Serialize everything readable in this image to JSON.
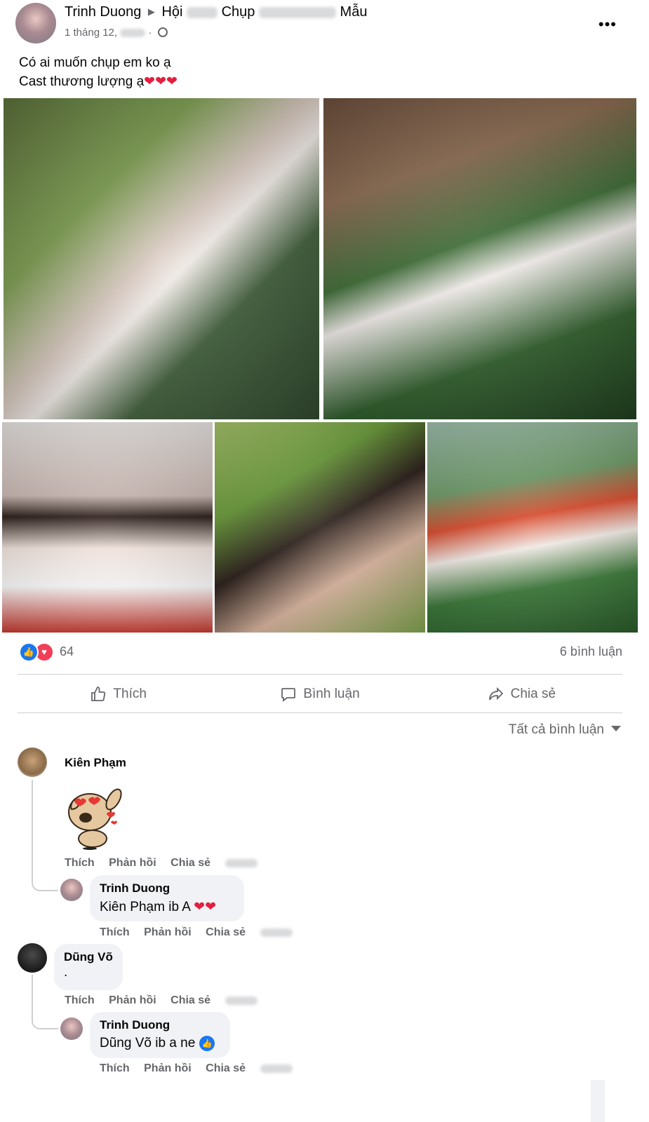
{
  "post": {
    "author": "Trinh Duong",
    "group_prefix": "Hội",
    "group_suffix": "Chụp",
    "group_last": "Mẫu",
    "date_prefix": "1 tháng 12,",
    "more_label": "•••",
    "text_lines": [
      "Có ai muốn chụp em ko ạ",
      "Cast thương lượng ạ"
    ],
    "hearts": "❤❤❤"
  },
  "photos": [
    "photo-1",
    "photo-2",
    "photo-3",
    "photo-4",
    "photo-5"
  ],
  "stats": {
    "reaction_count": "64",
    "comments": "6 bình luận"
  },
  "actions": {
    "like": "Thích",
    "comment": "Bình luận",
    "share": "Chia sẻ"
  },
  "filter": "Tất cả bình luận",
  "comments": [
    {
      "name": "Kiên Phạm",
      "sticker": "heart-eyes-dog-sticker",
      "actions": [
        "Thích",
        "Phản hồi",
        "Chia sẻ"
      ],
      "reply": {
        "name": "Trinh Duong",
        "text": "Kiên Phạm ib A ",
        "hearts": "❤❤",
        "actions": [
          "Thích",
          "Phản hồi",
          "Chia sẻ"
        ]
      }
    },
    {
      "name": "Dũng Võ",
      "text": ".",
      "actions": [
        "Thích",
        "Phản hồi",
        "Chia sẻ"
      ],
      "reply": {
        "name": "Trinh Duong",
        "text": "Dũng Võ ib a ne",
        "actions": [
          "Thích",
          "Phản hồi",
          "Chia sẻ"
        ]
      }
    }
  ],
  "colors": {
    "accent": "#1877f2",
    "love": "#f33e58",
    "heart": "#e41e3f",
    "secondary_text": "#65676b",
    "bubble": "#f0f2f5"
  }
}
